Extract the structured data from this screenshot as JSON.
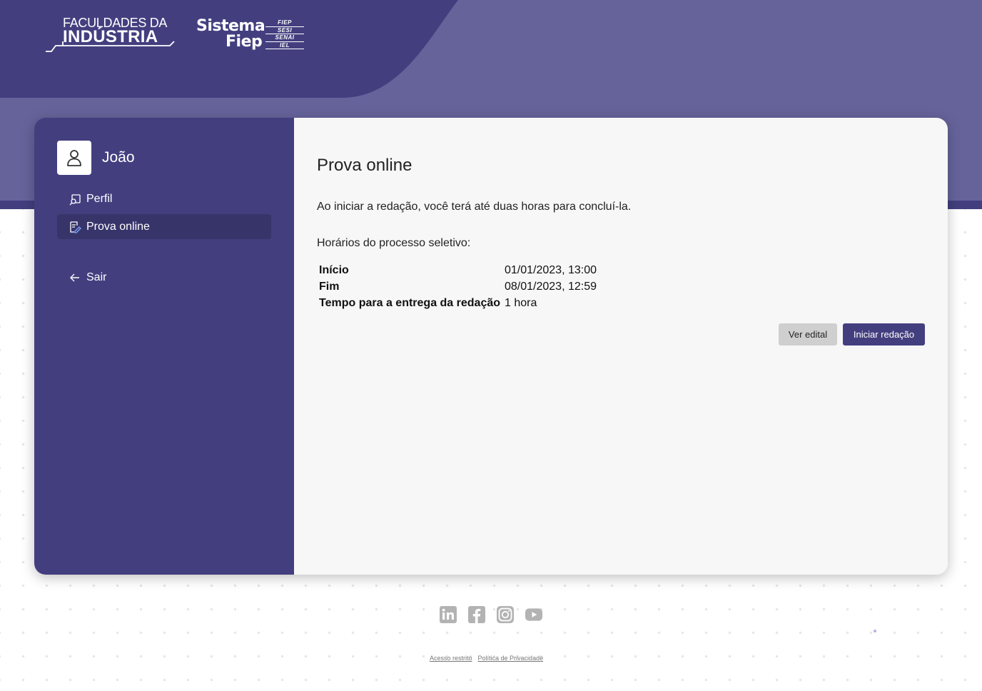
{
  "header": {
    "logo_fdi_line1": "FACULDADES DA",
    "logo_fdi_line2": "INDÚSTRIA",
    "logo_fiep_line1": "Sistema",
    "logo_fiep_line2": "Fiep",
    "logo_fiep_tags": [
      "FIEP",
      "SESI",
      "SENAI",
      "IEL"
    ]
  },
  "sidebar": {
    "user_name": "João",
    "items": [
      {
        "label": "Perfil",
        "icon": "profile-search-icon",
        "active": false
      },
      {
        "label": "Prova online",
        "icon": "edit-document-icon",
        "active": true
      },
      {
        "label": "Sair",
        "icon": "arrow-left-icon",
        "active": false
      }
    ]
  },
  "main": {
    "title": "Prova online",
    "intro": "Ao iniciar a redação, você terá até duas horas para concluí-la.",
    "schedule_title": "Horários do processo seletivo:",
    "schedule": [
      {
        "key": "Início",
        "value": "01/01/2023, 13:00"
      },
      {
        "key": "Fim",
        "value": "08/01/2023, 12:59"
      },
      {
        "key": "Tempo para a entrega da redação",
        "value": "1 hora"
      }
    ],
    "buttons": {
      "edital": "Ver edital",
      "iniciar": "Iniciar redação"
    }
  },
  "footer": {
    "social": [
      "linkedin-icon",
      "facebook-icon",
      "instagram-icon",
      "youtube-icon"
    ],
    "links": [
      "Acesso restrito",
      "Política de Privacidade"
    ]
  },
  "colors": {
    "primary": "#433f7f",
    "header_light": "#66639b",
    "sidebar_active": "#37346a"
  }
}
